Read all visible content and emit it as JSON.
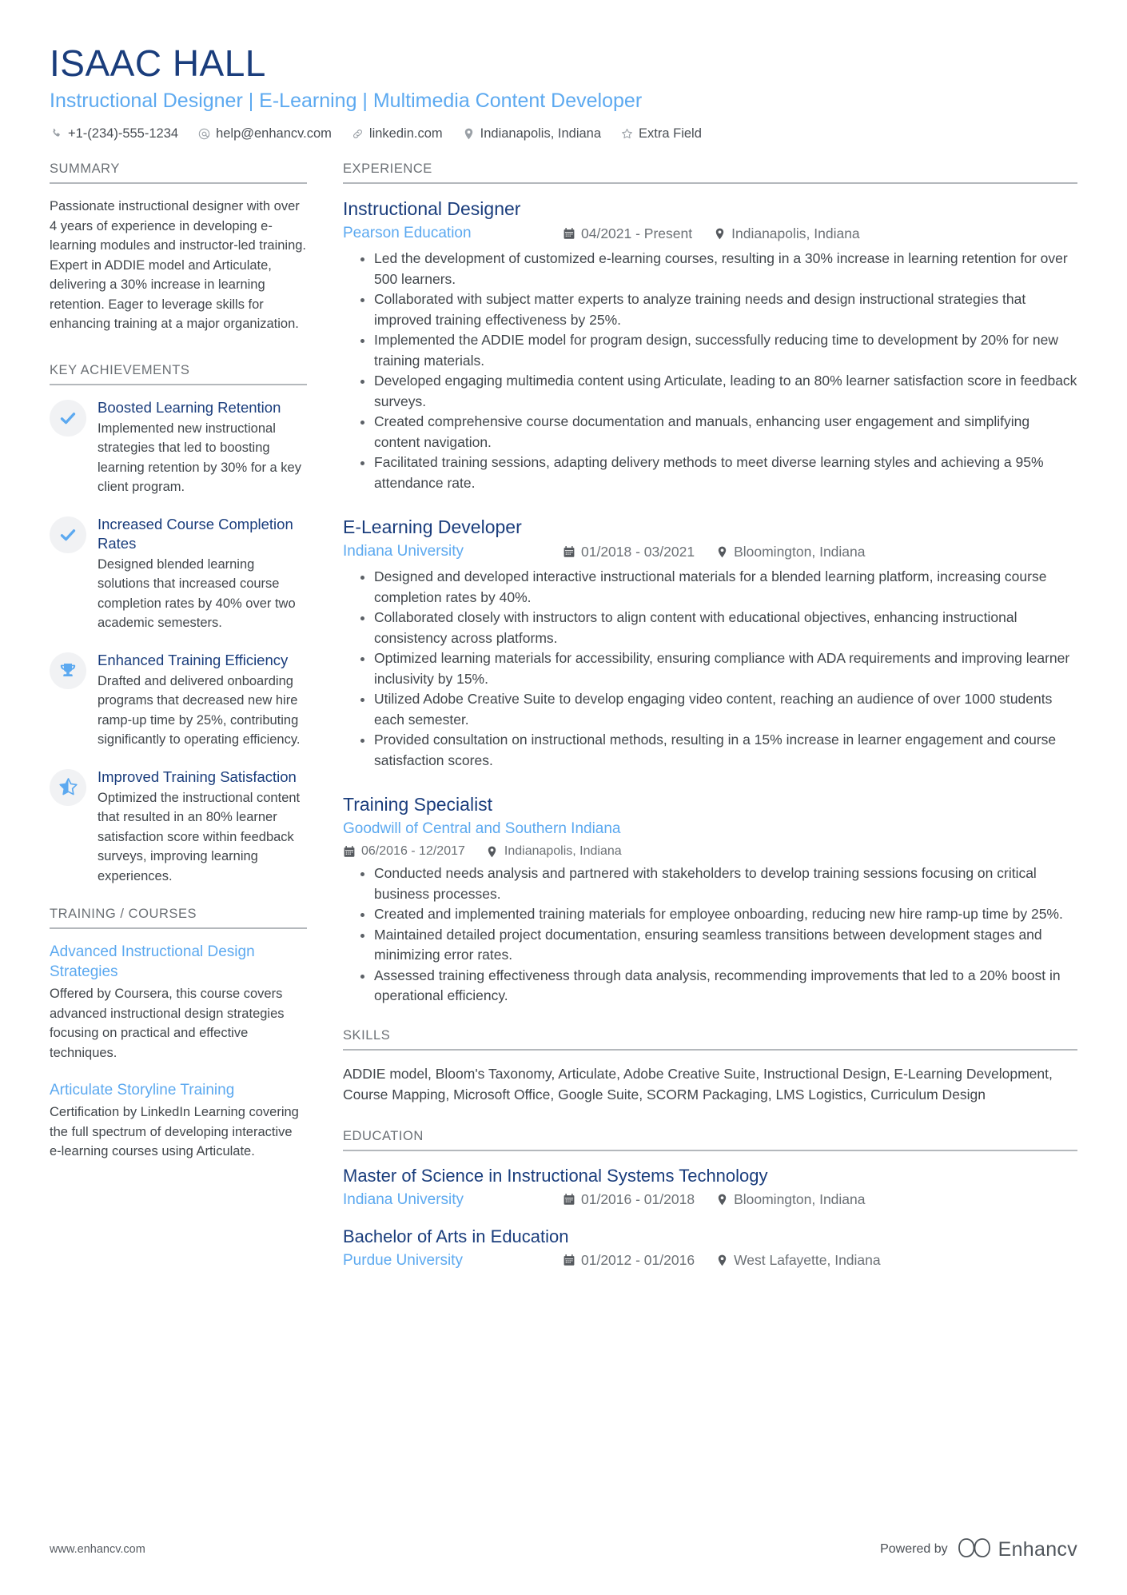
{
  "header": {
    "name": "ISAAC HALL",
    "role": "Instructional Designer | E-Learning | Multimedia Content Developer",
    "contacts": [
      {
        "icon": "phone-icon",
        "text": "+1-(234)-555-1234"
      },
      {
        "icon": "email-icon",
        "text": "help@enhancv.com"
      },
      {
        "icon": "link-icon",
        "text": "linkedin.com"
      },
      {
        "icon": "location-pin-icon",
        "text": "Indianapolis, Indiana"
      },
      {
        "icon": "star-icon",
        "text": "Extra Field"
      }
    ]
  },
  "colors": {
    "navy": "#1a3d7c",
    "sky": "#5ca9f0",
    "body": "#41464b",
    "muted": "#6b7075",
    "rule": "#b4b8bc",
    "icon_bg": "#f1f2f4"
  },
  "sidebar": {
    "summary": {
      "title": "SUMMARY",
      "text": "Passionate instructional designer with over 4 years of experience in developing e-learning modules and instructor-led training. Expert in ADDIE model and Articulate, delivering a 30% increase in learning retention. Eager to leverage skills for enhancing training at a major organization."
    },
    "achievements": {
      "title": "KEY ACHIEVEMENTS",
      "items": [
        {
          "icon": "check-icon",
          "title": "Boosted Learning Retention",
          "desc": "Implemented new instructional strategies that led to boosting learning retention by 30% for a key client program."
        },
        {
          "icon": "check-icon",
          "title": "Increased Course Completion Rates",
          "desc": "Designed blended learning solutions that increased course completion rates by 40% over two academic semesters."
        },
        {
          "icon": "trophy-icon",
          "title": "Enhanced Training Efficiency",
          "desc": "Drafted and delivered onboarding programs that decreased new hire ramp-up time by 25%, contributing significantly to operating efficiency."
        },
        {
          "icon": "half-star-icon",
          "title": "Improved Training Satisfaction",
          "desc": "Optimized the instructional content that resulted in an 80% learner satisfaction score within feedback surveys, improving learning experiences."
        }
      ]
    },
    "training": {
      "title": "TRAINING / COURSES",
      "items": [
        {
          "title": "Advanced Instructional Design Strategies",
          "desc": "Offered by Coursera, this course covers advanced instructional design strategies focusing on practical and effective techniques."
        },
        {
          "title": "Articulate Storyline Training",
          "desc": "Certification by LinkedIn Learning covering the full spectrum of developing interactive e-learning courses using Articulate."
        }
      ]
    }
  },
  "main": {
    "experience": {
      "title": "EXPERIENCE",
      "jobs": [
        {
          "title": "Instructional Designer",
          "company": "Pearson Education",
          "dates": "04/2021 - Present",
          "location": "Indianapolis, Indiana",
          "meta_layout": "inline",
          "bullets": [
            "Led the development of customized e-learning courses, resulting in a 30% increase in learning retention for over 500 learners.",
            "Collaborated with subject matter experts to analyze training needs and design instructional strategies that improved training effectiveness by 25%.",
            "Implemented the ADDIE model for program design, successfully reducing time to development by 20% for new training materials.",
            "Developed engaging multimedia content using Articulate, leading to an 80% learner satisfaction score in feedback surveys.",
            "Created comprehensive course documentation and manuals, enhancing user engagement and simplifying content navigation.",
            "Facilitated training sessions, adapting delivery methods to meet diverse learning styles and achieving a 95% attendance rate."
          ]
        },
        {
          "title": "E-Learning Developer",
          "company": "Indiana University",
          "dates": "01/2018 - 03/2021",
          "location": "Bloomington, Indiana",
          "meta_layout": "inline",
          "bullets": [
            "Designed and developed interactive instructional materials for a blended learning platform, increasing course completion rates by 40%.",
            "Collaborated closely with instructors to align content with educational objectives, enhancing instructional consistency across platforms.",
            "Optimized learning materials for accessibility, ensuring compliance with ADA requirements and improving learner inclusivity by 15%.",
            "Utilized Adobe Creative Suite to develop engaging video content, reaching an audience of over 1000 students each semester.",
            "Provided consultation on instructional methods, resulting in a 15% increase in learner engagement and course satisfaction scores."
          ]
        },
        {
          "title": "Training Specialist",
          "company": "Goodwill of Central and Southern Indiana",
          "dates": "06/2016 - 12/2017",
          "location": "Indianapolis, Indiana",
          "meta_layout": "stacked",
          "bullets": [
            "Conducted needs analysis and partnered with stakeholders to develop training sessions focusing on critical business processes.",
            "Created and implemented training materials for employee onboarding, reducing new hire ramp-up time by 25%.",
            "Maintained detailed project documentation, ensuring seamless transitions between development stages and minimizing error rates.",
            "Assessed training effectiveness through data analysis, recommending improvements that led to a 20% boost in operational efficiency."
          ]
        }
      ]
    },
    "skills": {
      "title": "SKILLS",
      "text": "ADDIE model, Bloom's Taxonomy, Articulate, Adobe Creative Suite, Instructional Design, E-Learning Development, Course Mapping, Microsoft Office, Google Suite, SCORM Packaging, LMS Logistics, Curriculum Design"
    },
    "education": {
      "title": "EDUCATION",
      "items": [
        {
          "degree": "Master of Science in Instructional Systems Technology",
          "school": "Indiana University",
          "dates": "01/2016 - 01/2018",
          "location": "Bloomington, Indiana"
        },
        {
          "degree": "Bachelor of Arts in Education",
          "school": "Purdue University",
          "dates": "01/2012 - 01/2016",
          "location": "West Lafayette, Indiana"
        }
      ]
    }
  },
  "footer": {
    "site": "www.enhancv.com",
    "powered_by": "Powered by",
    "brand": "Enhancv",
    "brand_logo_icon": "enhancv-infinity-logo-icon"
  }
}
